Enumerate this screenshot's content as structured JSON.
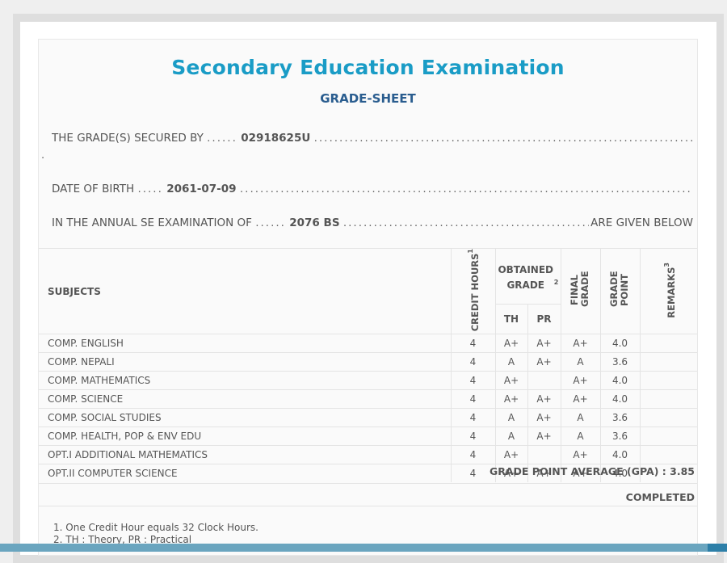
{
  "header": {
    "title": "Secondary Education Examination",
    "subtitle": "GRADE-SHEET"
  },
  "info": {
    "secured_by_label": "THE GRADE(S) SECURED BY",
    "symbol_no": "02918625U",
    "dob_label": "DATE OF BIRTH",
    "dob": "2061-07-09",
    "exam_label": "IN THE ANNUAL SE EXAMINATION OF",
    "exam_year": "2076 BS",
    "given_below": "ARE GIVEN BELOW"
  },
  "table": {
    "headers": {
      "subjects": "SUBJECTS",
      "credit_hours": "CREDIT HOURS",
      "credit_sup": "1",
      "obtained_grade": "OBTAINED GRADE",
      "obtained_sup": "2",
      "th": "TH",
      "pr": "PR",
      "final_grade": "FINAL GRADE",
      "grade_point": "GRADE POINT",
      "remarks": "REMARKS",
      "remarks_sup": "3"
    },
    "rows": [
      {
        "subject": "COMP. ENGLISH",
        "credit": "4",
        "th": "A+",
        "pr": "A+",
        "final": "A+",
        "gp": "4.0",
        "remarks": ""
      },
      {
        "subject": "COMP. NEPALI",
        "credit": "4",
        "th": "A",
        "pr": "A+",
        "final": "A",
        "gp": "3.6",
        "remarks": ""
      },
      {
        "subject": "COMP. MATHEMATICS",
        "credit": "4",
        "th": "A+",
        "pr": "",
        "final": "A+",
        "gp": "4.0",
        "remarks": ""
      },
      {
        "subject": "COMP. SCIENCE",
        "credit": "4",
        "th": "A+",
        "pr": "A+",
        "final": "A+",
        "gp": "4.0",
        "remarks": ""
      },
      {
        "subject": "COMP. SOCIAL STUDIES",
        "credit": "4",
        "th": "A",
        "pr": "A+",
        "final": "A",
        "gp": "3.6",
        "remarks": ""
      },
      {
        "subject": "COMP. HEALTH, POP & ENV EDU",
        "credit": "4",
        "th": "A",
        "pr": "A+",
        "final": "A",
        "gp": "3.6",
        "remarks": ""
      },
      {
        "subject": "OPT.I ADDITIONAL MATHEMATICS",
        "credit": "4",
        "th": "A+",
        "pr": "",
        "final": "A+",
        "gp": "4.0",
        "remarks": ""
      },
      {
        "subject": "OPT.II COMPUTER SCIENCE",
        "credit": "4",
        "th": "A+",
        "pr": "A+",
        "final": "A+",
        "gp": "4.0",
        "remarks": ""
      }
    ]
  },
  "summary": {
    "gpa_label": "GRADE POINT AVERAGE (GPA) :",
    "gpa_value": "3.85",
    "status": "COMPLETED"
  },
  "notes": [
    "1. One Credit Hour equals 32 Clock Hours.",
    "2. TH : Theory, PR : Practical"
  ],
  "colors": {
    "title": "#1a9cc6",
    "subtitle": "#2a5d8f",
    "bottom_bar": "#6aa5bf"
  }
}
